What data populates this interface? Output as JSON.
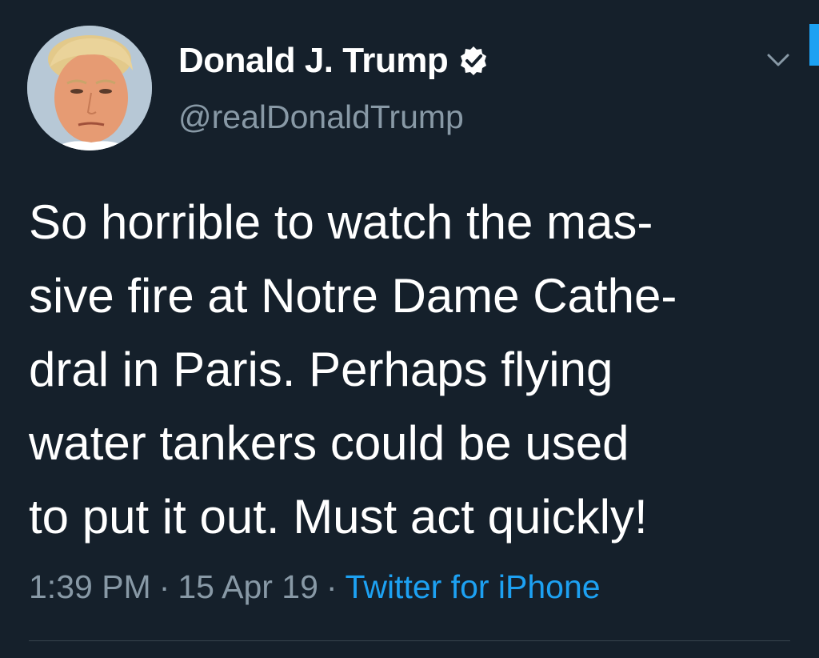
{
  "tweet": {
    "author": {
      "display_name": "Donald J. Trump",
      "handle": "@realDonaldTrump",
      "verified": true,
      "avatar_icon": "profile-photo"
    },
    "text_lines": [
      "So horrible to watch the mas-",
      "sive fire at Notre Dame Cathe-",
      "dral in Paris. Perhaps flying",
      "water tankers could be used",
      "to put it out. Must act quickly!"
    ],
    "meta": {
      "time": "1:39 PM",
      "separator": "·",
      "date": "15 Apr 19",
      "source": "Twitter for iPhone"
    },
    "menu_icon": "chevron-down-icon"
  },
  "colors": {
    "background": "#15202b",
    "primary_text": "#ffffff",
    "secondary_text": "#8899a6",
    "accent": "#1da1f2",
    "divider": "#38444d"
  }
}
